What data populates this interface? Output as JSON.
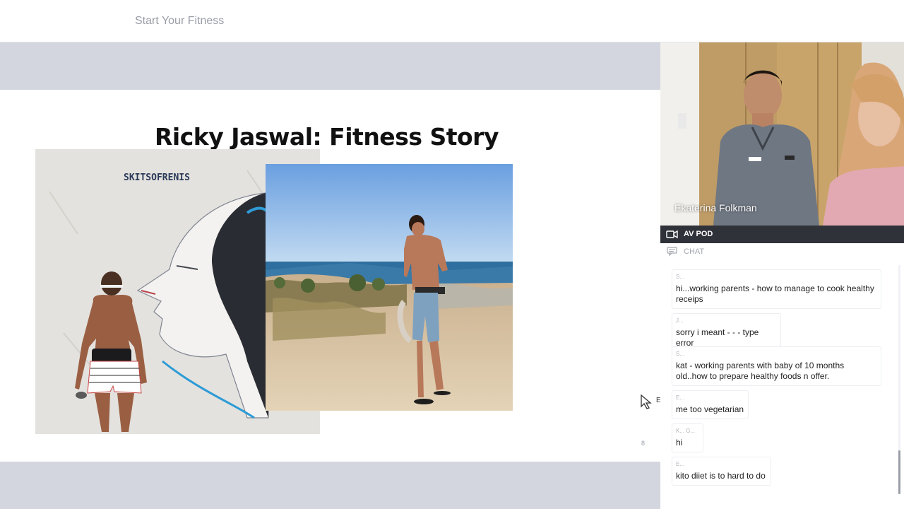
{
  "app": {
    "title": "Start Your Fitness"
  },
  "slide": {
    "title": "Ricky Jaswal: Fitness Story",
    "page_number": "8",
    "graffiti_text": "SKITSOFRENIS"
  },
  "cursor": {
    "label": "E"
  },
  "video": {
    "participant_name": "Ekaterina Folkman"
  },
  "pods": {
    "av_pod_label": "AV POD",
    "chat_label": "CHAT"
  },
  "chat": {
    "messages": [
      {
        "author": "S...",
        "text": "hi...working parents - how to manage to cook healthy receips"
      },
      {
        "author": "J...",
        "text": "sorry i meant - - - type error"
      },
      {
        "author": "S...",
        "text": "kat - working parents with baby of 10 months old..how to prepare healthy foods n offer."
      },
      {
        "author": "E...",
        "text": "me too vegetarian"
      },
      {
        "author": "K... G...",
        "text": "hi"
      },
      {
        "author": "E...",
        "text": "kito diiet is to hard to do"
      }
    ]
  },
  "colors": {
    "stage_bg": "#d3d6df",
    "pod_header_bg": "#30323a",
    "muted_text": "#9a9ea8"
  },
  "icons": {
    "video": "video-camera-icon",
    "chat": "chat-bubble-icon",
    "cursor": "mouse-pointer-icon"
  }
}
